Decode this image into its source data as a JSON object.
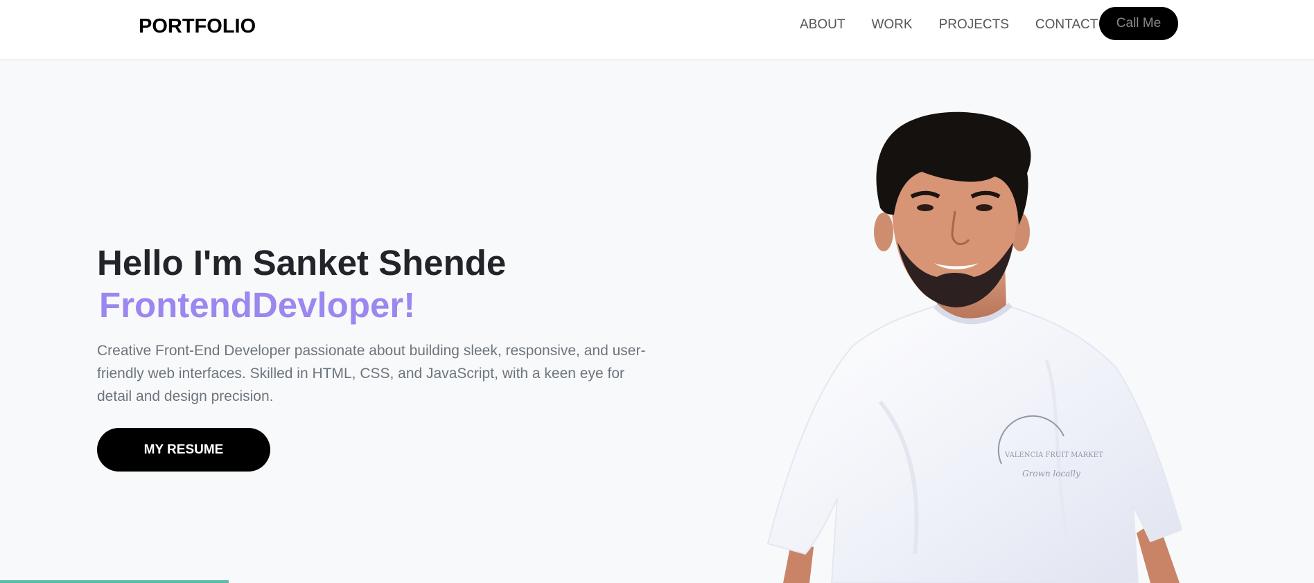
{
  "brand": "PORTFOLIO",
  "nav": {
    "links": [
      "ABOUT",
      "WORK",
      "PROJECTS",
      "CONTACT"
    ],
    "call_label": "Call Me"
  },
  "hero": {
    "greeting": "Hello I'm Sanket Shende",
    "role": "FrontendDevloper!",
    "description": "Creative Front-End Developer passionate about building sleek, responsive, and user-friendly web interfaces. Skilled in HTML, CSS, and JavaScript, with a keen eye for detail and design precision.",
    "resume_label": "MY RESUME"
  },
  "portrait": {
    "shirt_text_top": "VALENCIA FRUIT MARKET",
    "shirt_text_script": "Grown locally"
  },
  "colors": {
    "accent": "#9b87ef",
    "button": "#000000",
    "background": "#f8f9fa",
    "teal": "#5cbca8"
  }
}
